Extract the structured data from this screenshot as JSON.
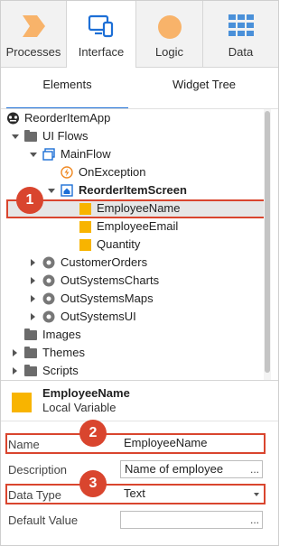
{
  "top_tabs": [
    {
      "label": "Processes",
      "icon": "processes-icon"
    },
    {
      "label": "Interface",
      "icon": "interface-icon"
    },
    {
      "label": "Logic",
      "icon": "logic-icon"
    },
    {
      "label": "Data",
      "icon": "data-icon"
    }
  ],
  "sub_tabs": {
    "elements": "Elements",
    "widget_tree": "Widget Tree"
  },
  "tree": {
    "app": "ReorderItemApp",
    "ui_flows": "UI Flows",
    "main_flow": "MainFlow",
    "on_exception": "OnException",
    "screen": "ReorderItemScreen",
    "var1": "EmployeeName",
    "var2": "EmployeeEmail",
    "var3": "Quantity",
    "mod1": "CustomerOrders",
    "mod2": "OutSystemsCharts",
    "mod3": "OutSystemsMaps",
    "mod4": "OutSystemsUI",
    "images": "Images",
    "themes": "Themes",
    "scripts": "Scripts"
  },
  "badges": {
    "b1": "1",
    "b2": "2",
    "b3": "3"
  },
  "properties": {
    "title": "EmployeeName",
    "kind": "Local Variable",
    "name_label": "Name",
    "name_value": "EmployeeName",
    "description_label": "Description",
    "description_value": "Name of employee",
    "data_type_label": "Data Type",
    "data_type_value": "Text",
    "default_value_label": "Default Value",
    "default_value_value": "",
    "ellipsis": "..."
  },
  "colors": {
    "accent": "#1d6fd6",
    "highlight": "#d9452e",
    "variable": "#f8b400",
    "processes": "#f8b36a",
    "logic": "#f8b36a",
    "data": "#4a90d9"
  }
}
